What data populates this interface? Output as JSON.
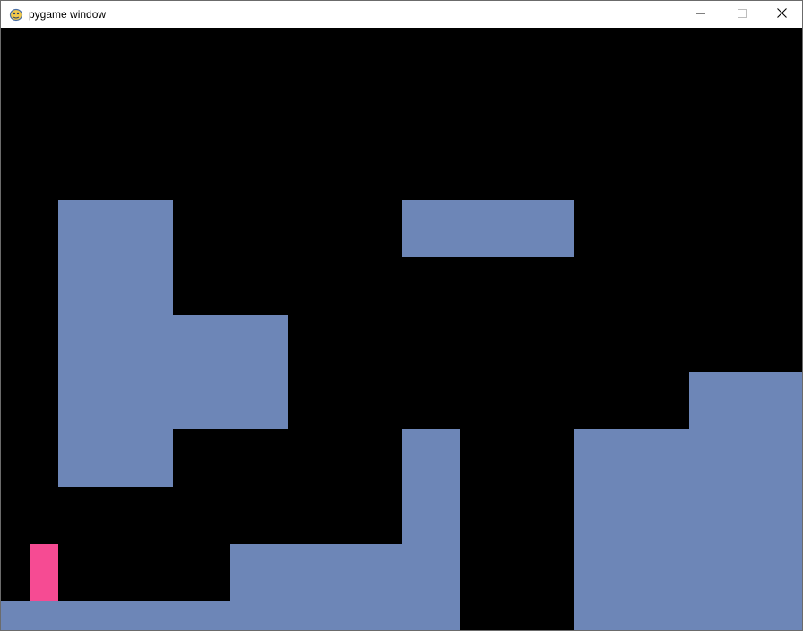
{
  "window": {
    "title": "pygame window",
    "app_icon": "pygame-snake-icon",
    "controls": {
      "minimize_icon": "minimize-icon",
      "maximize_icon": "maximize-icon",
      "close_icon": "close-icon"
    }
  },
  "game": {
    "background_color": "#000000",
    "tile_color": "#6d86b7",
    "player_color": "#f64b93"
  }
}
